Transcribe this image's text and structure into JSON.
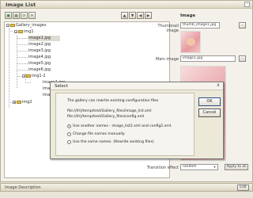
{
  "panel": {
    "title": "Image List",
    "toggle": "–"
  },
  "toolbar_icons": [
    "add-folder-icon",
    "add-image-icon",
    "refresh-icon",
    "delete-icon",
    "move-up-icon",
    "move-down-icon",
    "move-left-icon",
    "move-right-icon"
  ],
  "tree": {
    "root": "Gallery_images",
    "img1_folder": "img1",
    "img1_items": [
      "image1.jpg",
      "image2.jpg",
      "image3.jpg",
      "image4.jpg",
      "image5.jpg",
      "image6.jpg"
    ],
    "img12_folder": "img1-2",
    "img12_items": [
      "image1.jpg",
      "image2.jpg",
      "image3.jpg"
    ],
    "img2_folder": "img2"
  },
  "image_section": {
    "heading": "Image",
    "thumbnail_label": "Thumbnail image",
    "thumbnail_value": "thumb_image1.jpg",
    "main_label": "Main image",
    "main_value": "image1.jpg",
    "browse_label": "...",
    "transition_label": "Transition effect",
    "transition_value": "random",
    "apply_label": "Apply to all"
  },
  "bottom": {
    "label": "Image Description",
    "edit": "Edit"
  },
  "dialog": {
    "title": "Select",
    "close": "x",
    "message": "The gallery can rewrite existing configuration files",
    "path1": "file:///H|/temp/test/Gallery_files/image_list.xml",
    "path2": "file:///H|/temp/test/Gallery_files/config.xml",
    "options": [
      "Use another names - image_list2.xml and config2.xml.",
      "Change file names manually.",
      "Use the same names. (Rewrite existing files)"
    ],
    "selected_option_index": 0,
    "ok": "OK",
    "cancel": "Cancel"
  }
}
